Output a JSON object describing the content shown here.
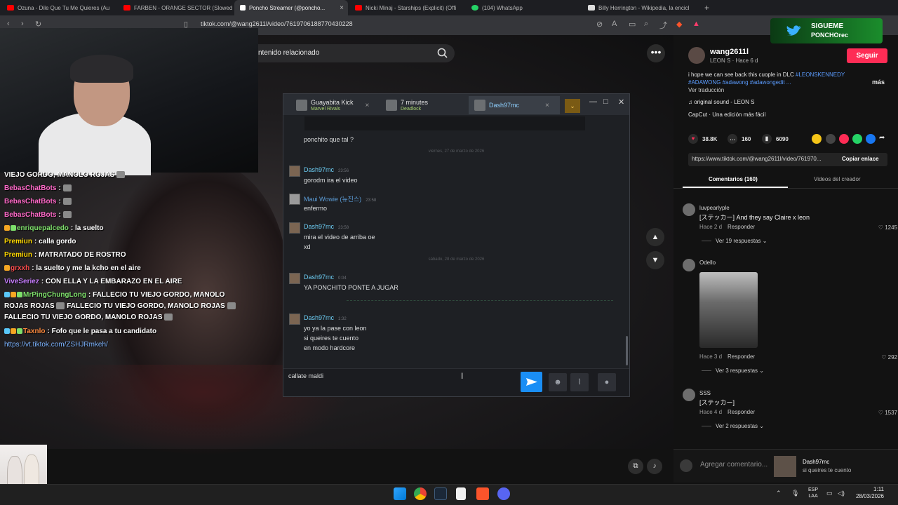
{
  "browser": {
    "tabs": [
      {
        "label": "Ozuna - Dile Que Tu Me Quieres (Au",
        "color": "#ff0000"
      },
      {
        "label": "FARBEN - ORANGE SECTOR (Slowed",
        "color": "#ff0000"
      },
      {
        "label": "Poncho Streamer (@poncho...",
        "color": "#ffffff",
        "close": "×"
      },
      {
        "label": "Nicki Minaj - Starships (Explicit) (Offi",
        "color": "#ff0000"
      },
      {
        "label": "(104) WhatsApp",
        "color": "#25d366"
      },
      {
        "label": "Billy Herrington - Wikipedia, la encicl",
        "color": "#dddddd"
      }
    ],
    "new_tab": "+",
    "url": "tiktok.com/@wang2611l/video/7619706188770430228"
  },
  "video": {
    "search_text": "ntenido relacionado",
    "more": "•••",
    "nav_up": "▲",
    "nav_down": "▼"
  },
  "stream_chat": [
    {
      "user": "",
      "text": "VIEJO GORDO, MANOLO ROJAS",
      "color": "#ffffff"
    },
    {
      "user": "BebasChatBots",
      "text": ":",
      "color": "#ff69c8"
    },
    {
      "user": "BebasChatBots",
      "text": ":",
      "color": "#ff69c8"
    },
    {
      "user": "BebasChatBots",
      "text": ":",
      "color": "#ff69c8"
    },
    {
      "user": "enriquepalcedo",
      "text": ": la suelto",
      "color": "#7ee06b"
    },
    {
      "user": "Premiun",
      "text": ": calla gordo",
      "color": "#ffd700"
    },
    {
      "user": "Premiun",
      "text": ": MATRATADO DE ROSTRO",
      "color": "#ffd700"
    },
    {
      "user": "grxxh",
      "text": ": la suelto y me la kcho en el aire",
      "color": "#ff4c4c"
    },
    {
      "user": "ViveSeriez",
      "text": ": CON ELLA Y LA EMBARAZO EN EL AIRE",
      "color": "#c77dff"
    },
    {
      "user": "MrPingChungLong",
      "text": ": FALLECIO TU VIEJO GORDO, MANOLO ROJAS",
      "cont1": "FALLECIO TU VIEJO GORDO, MANOLO ROJAS",
      "cont2": "FALLECIO TU VIEJO GORDO, MANOLO ROJAS",
      "color": "#7ee06b"
    },
    {
      "user": "Taxnlo",
      "text": ": Fofo que le pasa a tu candidato",
      "color": "#ff8a3d"
    }
  ],
  "stream_chat_link": "https://vt.tiktok.com/ZSHJRmkeh/",
  "steam": {
    "tabs": [
      {
        "name": "Guayabita Kick",
        "game": "Marvel Rivals"
      },
      {
        "name": "7 minutes",
        "game": "Deadlock"
      },
      {
        "name": "Dash97mc",
        "game": ""
      }
    ],
    "close": "×",
    "dropdown": "⌄",
    "win_min": "—",
    "win_max": "□",
    "win_close": "✕",
    "messages": [
      {
        "lines": [
          "ponchito que tal ?"
        ]
      },
      {
        "separator": "viernes, 27 de marzo de 2026"
      },
      {
        "user": "Dash97mc",
        "time": "23:56",
        "lines": [
          "gorodm ira el video"
        ]
      },
      {
        "user": "Maui Wowie (뉴진스)",
        "time": "23:58",
        "lines": [
          "enfermo"
        ]
      },
      {
        "user": "Dash97mc",
        "time": "23:58",
        "lines": [
          "mira el video de arriba oe",
          "xd"
        ]
      },
      {
        "separator": "sábado, 28 de marzo de 2026"
      },
      {
        "user": "Dash97mc",
        "time": "0:04",
        "lines": [
          "YA PONCHITO PONTE A JUGAR"
        ]
      },
      {
        "user": "Dash97mc",
        "time": "1:32",
        "lines": [
          "yo ya la pase con leon",
          "si queires te cuento",
          "en modo hardcore"
        ]
      }
    ],
    "input_value": "callate maldi"
  },
  "tiktok": {
    "banner_line1": "SIGUEME",
    "banner_line2": "PONCHOrec",
    "author": "wang2611l",
    "author_sub": "LEON S · Hace 6 d",
    "follow": "Seguir",
    "desc_text": "i hope we can see back this cuople in DLC ",
    "desc_tags": "#LEONSKENNEDY #ADAWONG #adawong #adawongedit ...",
    "more": "más",
    "translate": "Ver traducción",
    "sound": "♫  original sound - LEON S",
    "capcut": "CapCut · Una edición más fácil",
    "likes": "38.8K",
    "comments_count": "160",
    "saves": "6090",
    "link": "https://www.tiktok.com/@wang2611l/video/761970...",
    "copy": "Copiar enlace",
    "tab_comments": "Comentarios (160)",
    "tab_videos": "Videos del creador",
    "comments": [
      {
        "user": "luvpearlyple",
        "text": "[ステッカー] And they say Claire x leon",
        "time": "Hace 2 d",
        "reply": "Responder",
        "likes": "1245",
        "replies": "Ver 19 respuestas ⌄"
      },
      {
        "user": "Odello",
        "text": "",
        "time": "Hace 3 d",
        "reply": "Responder",
        "likes": "292",
        "replies": "Ver 3 respuestas ⌄"
      },
      {
        "user": "SSS",
        "text": "[ステッカー]",
        "time": "Hace 4 d",
        "reply": "Responder",
        "likes": "1537",
        "replies": "Ver 2 respuestas ⌄"
      }
    ],
    "cmt_placeholder": "Agregar comentario...",
    "notif_name": "Dash97mc",
    "notif_msg": "si queires te cuento"
  },
  "taskbar": {
    "lang1": "ESP",
    "lang2": "LAA",
    "time": "1:11",
    "date": "28/03/2026"
  }
}
